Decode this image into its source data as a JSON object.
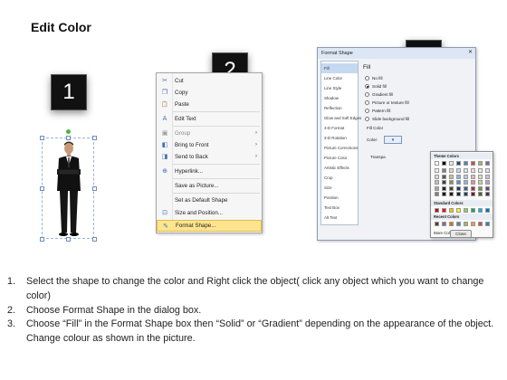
{
  "title": "Edit Color",
  "badges": [
    "1",
    "2",
    "3"
  ],
  "context_menu": {
    "items": [
      {
        "icon": "cut-icon",
        "glyph": "✂",
        "label": "Cut",
        "arrow": "",
        "state": "normal"
      },
      {
        "icon": "copy-icon",
        "glyph": "❐",
        "label": "Copy",
        "arrow": "",
        "state": "normal"
      },
      {
        "icon": "paste-icon",
        "glyph": "📋",
        "label": "Paste",
        "arrow": "",
        "state": "normal"
      },
      {
        "icon": "edit-text-icon",
        "glyph": "A",
        "label": "Edit Text",
        "arrow": "",
        "state": "normal"
      },
      {
        "icon": "group-icon",
        "glyph": "▣",
        "label": "Group",
        "arrow": "›",
        "state": "dim"
      },
      {
        "icon": "bring-to-front-icon",
        "glyph": "◧",
        "label": "Bring to Front",
        "arrow": "›",
        "state": "normal"
      },
      {
        "icon": "send-to-back-icon",
        "glyph": "◨",
        "label": "Send to Back",
        "arrow": "›",
        "state": "normal"
      },
      {
        "icon": "hyperlink-icon",
        "glyph": "⊕",
        "label": "Hyperlink...",
        "arrow": "",
        "state": "normal"
      },
      {
        "icon": "",
        "glyph": "",
        "label": "Save as Picture...",
        "arrow": "",
        "state": "normal"
      },
      {
        "icon": "",
        "glyph": "",
        "label": "Set as Default Shape",
        "arrow": "",
        "state": "normal"
      },
      {
        "icon": "size-position-icon",
        "glyph": "⊡",
        "label": "Size and Position...",
        "arrow": "",
        "state": "normal"
      },
      {
        "icon": "format-shape-icon",
        "glyph": "✎",
        "label": "Format Shape...",
        "arrow": "",
        "state": "highlight"
      }
    ]
  },
  "dialog": {
    "title": "Format Shape",
    "close_glyph": "✕",
    "nav": [
      "Fill",
      "Line Color",
      "Line Style",
      "Shadow",
      "Reflection",
      "Glow and Soft Edges",
      "3-D Format",
      "3-D Rotation",
      "Picture Corrections",
      "Picture Color",
      "Artistic Effects",
      "Crop",
      "Size",
      "Position",
      "Text Box",
      "Alt Text"
    ],
    "selected_nav": "Fill",
    "panel_heading": "Fill",
    "options": [
      {
        "label": "No fill",
        "selected": false
      },
      {
        "label": "Solid fill",
        "selected": true
      },
      {
        "label": "Gradient fill",
        "selected": false
      },
      {
        "label": "Picture or texture fill",
        "selected": false
      },
      {
        "label": "Pattern fill",
        "selected": false
      },
      {
        "label": "Slide background fill",
        "selected": false
      }
    ],
    "fill_color_label": "Fill Color",
    "color_label": "Color:",
    "transparency_label": "Transpa",
    "palette": {
      "theme_heading": "Theme Colors",
      "standard_heading": "Standard Colors",
      "recent_heading": "Recent Colors",
      "more_colors": "More Colors...",
      "theme_top": [
        "#ffffff",
        "#000000",
        "#eeece1",
        "#1f497d",
        "#4f81bd",
        "#c0504d",
        "#9bbb59",
        "#8064a2"
      ],
      "theme_cols": [
        [
          "#f2f2f2",
          "#d9d9d9",
          "#bfbfbf",
          "#a6a6a6",
          "#808080"
        ],
        [
          "#7f7f7f",
          "#595959",
          "#404040",
          "#262626",
          "#0d0d0d"
        ],
        [
          "#ddd9c3",
          "#c4bd97",
          "#948a54",
          "#4a452a",
          "#1d1b10"
        ],
        [
          "#c6d9f0",
          "#8db3e2",
          "#548dd4",
          "#17365d",
          "#0f243e"
        ],
        [
          "#dbe5f1",
          "#b8cce4",
          "#95b3d7",
          "#366092",
          "#244061"
        ],
        [
          "#f2dcdb",
          "#e5b9b7",
          "#d99694",
          "#953734",
          "#632423"
        ],
        [
          "#ebf1dd",
          "#d7e3bc",
          "#c3d69b",
          "#76923c",
          "#4f6128"
        ],
        [
          "#e5e0ec",
          "#ccc1d9",
          "#b2a2c7",
          "#5f497a",
          "#3f3151"
        ]
      ],
      "standard": [
        "#c00000",
        "#ff0000",
        "#ffc000",
        "#ffff00",
        "#92d050",
        "#00b050",
        "#00b0f0",
        "#0070c0"
      ],
      "recent": [
        "#5b3a1c",
        "#8064a2",
        "#e36c09",
        "#4f81bd",
        "#9bbb59",
        "#f79646",
        "#c0504d",
        "#31859c"
      ]
    },
    "close_button": "Close"
  },
  "steps": [
    {
      "num": "1.",
      "text": "Select the shape to change the color and Right click the object( click any object which you want to change color)"
    },
    {
      "num": "2.",
      "text": "Choose Format Shape in the dialog box."
    },
    {
      "num": "3.",
      "text": "Choose “Fill” in the Format Shape box then “Solid” or “Gradient” depending on the appearance of the object. Change colour as shown in the picture."
    }
  ]
}
